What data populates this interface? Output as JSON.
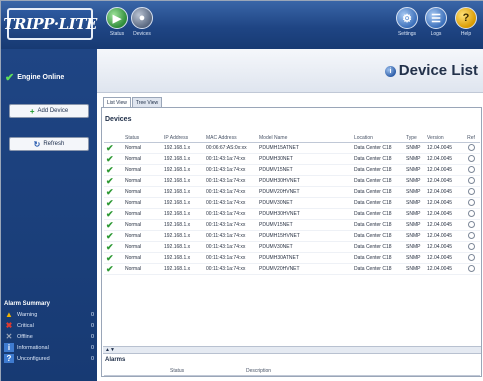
{
  "header": {
    "logo_text": "TRIPP·LITE",
    "left_buttons": [
      {
        "label": "Status",
        "icon": "status-icon"
      },
      {
        "label": "Devices",
        "icon": "devices-icon"
      }
    ],
    "right_buttons": [
      {
        "label": "Settings",
        "icon": "settings-icon"
      },
      {
        "label": "Logs",
        "icon": "logs-icon"
      },
      {
        "label": "Help",
        "icon": "help-icon"
      }
    ]
  },
  "sidebar": {
    "engine_status": "Engine Online",
    "add_device_label": "Add Device",
    "refresh_label": "Refresh",
    "alarm_summary": {
      "title": "Alarm Summary",
      "items": [
        {
          "name": "Warning",
          "count": "0",
          "color": "#f2b400"
        },
        {
          "name": "Critical",
          "count": "0",
          "color": "#e03a2f"
        },
        {
          "name": "Offline",
          "count": "0",
          "color": "#9aa6b8"
        },
        {
          "name": "Informational",
          "count": "0",
          "color": "#3f7bd0"
        },
        {
          "name": "Unconfigured",
          "count": "0",
          "color": "#3f7bd0"
        }
      ]
    }
  },
  "main": {
    "title": "Device List",
    "tabs": [
      {
        "label": "List View",
        "active": true
      },
      {
        "label": "Tree View",
        "active": false
      }
    ],
    "devices_heading": "Devices",
    "columns": [
      "Status",
      "IP Address",
      "MAC Address",
      "Model Name",
      "Location",
      "Type",
      "Version",
      "Ref"
    ],
    "rows": [
      {
        "status": "Normal",
        "ip": "192.168.1.x",
        "mac": "00:06:67:AS:0x:xx",
        "model": "PDUMH15ATNET",
        "location": "Data Center C18",
        "type": "SNMP",
        "version": "12.04.0045"
      },
      {
        "status": "Normal",
        "ip": "192.168.1.x",
        "mac": "00:11:43:1a:74:xx",
        "model": "PDUMH30NET",
        "location": "Data Center C18",
        "type": "SNMP",
        "version": "12.04.0045"
      },
      {
        "status": "Normal",
        "ip": "192.168.1.x",
        "mac": "00:11:43:1a:74:xx",
        "model": "PDUMV15NET",
        "location": "Data Center C18",
        "type": "SNMP",
        "version": "12.04.0045"
      },
      {
        "status": "Normal",
        "ip": "192.168.1.x",
        "mac": "00:11:43:1a:74:xx",
        "model": "PDUMH30HVNET",
        "location": "Data Center C18",
        "type": "SNMP",
        "version": "12.04.0045"
      },
      {
        "status": "Normal",
        "ip": "192.168.1.x",
        "mac": "00:11:43:1a:74:xx",
        "model": "PDUMV20HVNET",
        "location": "Data Center C18",
        "type": "SNMP",
        "version": "12.04.0045"
      },
      {
        "status": "Normal",
        "ip": "192.168.1.x",
        "mac": "00:11:43:1a:74:xx",
        "model": "PDUMV30NET",
        "location": "Data Center C18",
        "type": "SNMP",
        "version": "12.04.0045"
      },
      {
        "status": "Normal",
        "ip": "192.168.1.x",
        "mac": "00:11:43:1a:74:xx",
        "model": "PDUMH30HVNET",
        "location": "Data Center C18",
        "type": "SNMP",
        "version": "12.04.0045"
      },
      {
        "status": "Normal",
        "ip": "192.168.1.x",
        "mac": "00:11:43:1a:74:xx",
        "model": "PDUMV15NET",
        "location": "Data Center C18",
        "type": "SNMP",
        "version": "12.04.0045"
      },
      {
        "status": "Normal",
        "ip": "192.168.1.x",
        "mac": "00:11:43:1a:74:xx",
        "model": "PDUMH15HVNET",
        "location": "Data Center C18",
        "type": "SNMP",
        "version": "12.04.0045"
      },
      {
        "status": "Normal",
        "ip": "192.168.1.x",
        "mac": "00:11:43:1a:74:xx",
        "model": "PDUMV30NET",
        "location": "Data Center C18",
        "type": "SNMP",
        "version": "12.04.0045"
      },
      {
        "status": "Normal",
        "ip": "192.168.1.x",
        "mac": "00:11:43:1a:74:xx",
        "model": "PDUMH30ATNET",
        "location": "Data Center C18",
        "type": "SNMP",
        "version": "12.04.0045"
      },
      {
        "status": "Normal",
        "ip": "192.168.1.x",
        "mac": "00:11:43:1a:74:xx",
        "model": "PDUMV20HVNET",
        "location": "Data Center C18",
        "type": "SNMP",
        "version": "12.04.0045"
      }
    ],
    "alarms": {
      "heading": "Alarms",
      "columns": [
        "Status",
        "Description"
      ]
    }
  }
}
